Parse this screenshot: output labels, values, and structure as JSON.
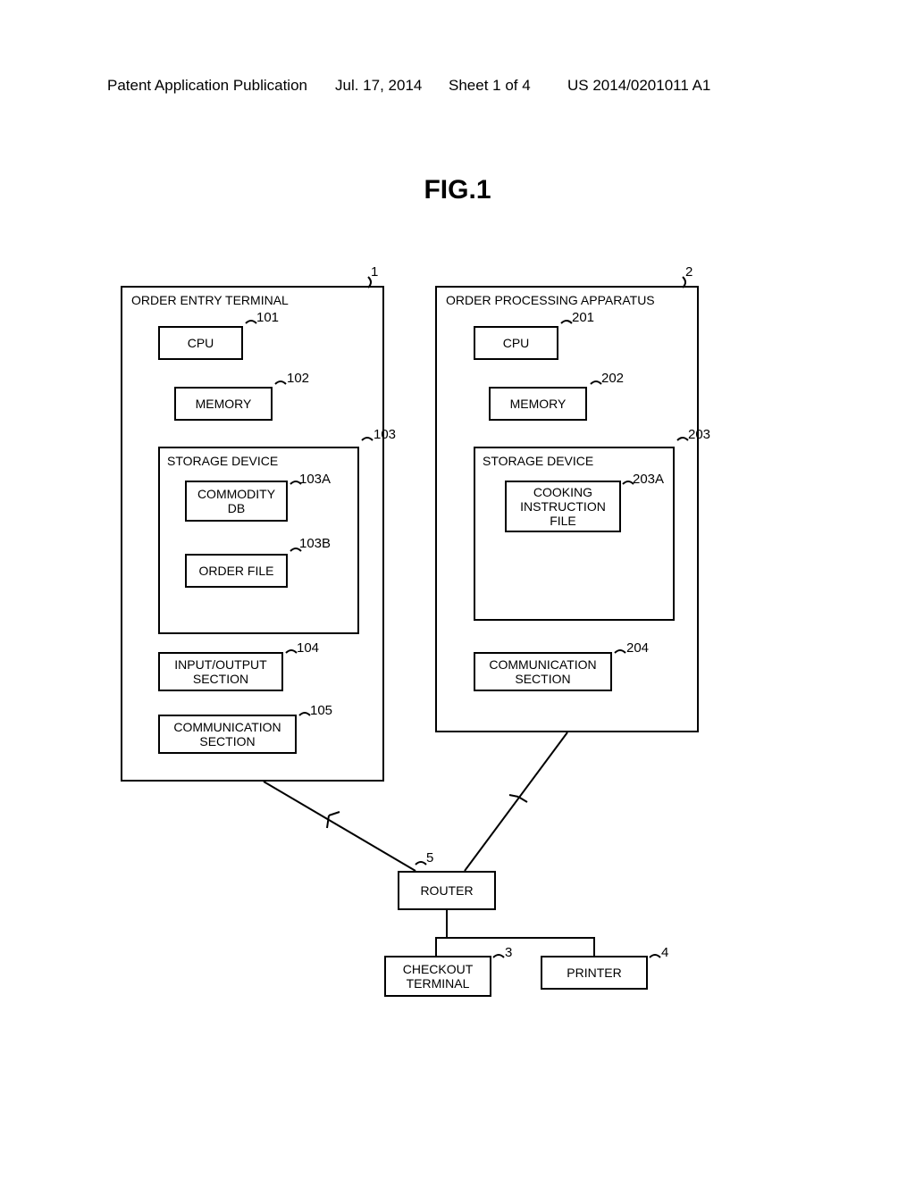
{
  "header": {
    "left": "Patent Application Publication",
    "date": "Jul. 17, 2014",
    "sheet": "Sheet 1 of 4",
    "pubno": "US 2014/0201011 A1"
  },
  "figure_title": "FIG.1",
  "blocks": {
    "order_entry_terminal": {
      "title": "ORDER ENTRY TERMINAL",
      "cpu": "CPU",
      "memory": "MEMORY",
      "storage_device": "STORAGE DEVICE",
      "commodity_db": "COMMODITY\nDB",
      "order_file": "ORDER FILE",
      "io_section": "INPUT/OUTPUT\nSECTION",
      "comm_section": "COMMUNICATION\nSECTION"
    },
    "order_processing_apparatus": {
      "title": "ORDER PROCESSING APPARATUS",
      "cpu": "CPU",
      "memory": "MEMORY",
      "storage_device": "STORAGE DEVICE",
      "cooking_instruction_file": "COOKING\nINSTRUCTION\nFILE",
      "comm_section": "COMMUNICATION\nSECTION"
    },
    "router": "ROUTER",
    "checkout_terminal": "CHECKOUT\nTERMINAL",
    "printer": "PRINTER"
  },
  "refs": {
    "oet": "1",
    "opa": "2",
    "oet_cpu": "101",
    "oet_mem": "102",
    "oet_sd": "103",
    "oet_db": "103A",
    "oet_of": "103B",
    "oet_io": "104",
    "oet_com": "105",
    "opa_cpu": "201",
    "opa_mem": "202",
    "opa_sd": "203",
    "opa_cif": "203A",
    "opa_com": "204",
    "router": "5",
    "chk": "3",
    "prn": "4"
  }
}
